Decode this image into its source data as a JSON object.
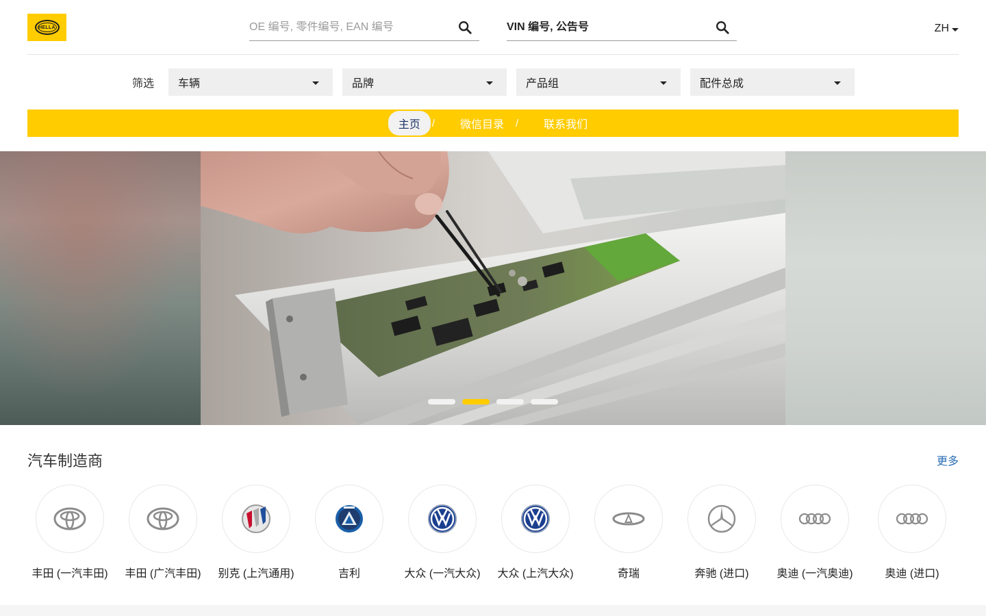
{
  "header": {
    "logo_text": "HELLA",
    "search_part_placeholder": "OE 编号, 零件编号, EAN 编号",
    "search_vin_placeholder": "VIN 编号, 公告号",
    "language": "ZH"
  },
  "filters": {
    "label": "筛选",
    "selects": [
      {
        "value": "车辆"
      },
      {
        "value": "品牌"
      },
      {
        "value": "产品组"
      },
      {
        "value": "配件总成"
      }
    ]
  },
  "nav": {
    "items": [
      {
        "label": "主页",
        "active": true
      },
      {
        "label": "微信目录",
        "active": false
      },
      {
        "label": "联系我们",
        "active": false
      }
    ],
    "separator": "/"
  },
  "hero": {
    "slide_count": 4,
    "active_slide": 2,
    "image": "technician-pcb-tweezers"
  },
  "manufacturers": {
    "title": "汽车制造商",
    "more_label": "更多",
    "brands": [
      {
        "name": "丰田 (一汽丰田)",
        "icon": "toyota-logo-icon"
      },
      {
        "name": "丰田 (广汽丰田)",
        "icon": "toyota-logo-icon"
      },
      {
        "name": "别克 (上汽通用)",
        "icon": "buick-logo-icon"
      },
      {
        "name": "吉利",
        "icon": "geely-logo-icon"
      },
      {
        "name": "大众 (一汽大众)",
        "icon": "volkswagen-logo-icon"
      },
      {
        "name": "大众 (上汽大众)",
        "icon": "volkswagen-logo-icon"
      },
      {
        "name": "奇瑞",
        "icon": "chery-logo-icon"
      },
      {
        "name": "奔驰 (进口)",
        "icon": "mercedes-logo-icon"
      },
      {
        "name": "奥迪 (一汽奥迪)",
        "icon": "audi-logo-icon"
      },
      {
        "name": "奥迪 (进口)",
        "icon": "audi-logo-icon"
      }
    ]
  },
  "colors": {
    "brand_yellow": "#ffcc00",
    "nav_active_text": "#1a2f62",
    "link_blue": "#2a6fb5"
  }
}
